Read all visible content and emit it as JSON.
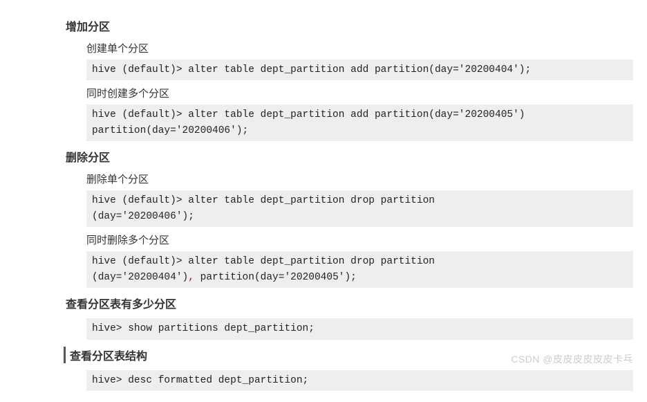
{
  "sec1": {
    "title": "增加分区",
    "sub1": "创建单个分区",
    "code1": "hive (default)> alter table dept_partition add partition(day='20200404');",
    "sub2": "同时创建多个分区",
    "code2": "hive (default)> alter table dept_partition add partition(day='20200405') \npartition(day='20200406');"
  },
  "sec2": {
    "title": "删除分区",
    "sub1": "删除单个分区",
    "code1": "hive (default)> alter table dept_partition drop partition \n(day='20200406');",
    "sub2": "同时删除多个分区",
    "code2a": "hive (default)> alter table dept_partition drop partition \n(day='20200404')",
    "code2comma": ",",
    "code2b": " partition(day='20200405');"
  },
  "sec3": {
    "title": "查看分区表有多少分区",
    "code1": "hive> show partitions dept_partition;"
  },
  "sec4": {
    "title": "查看分区表结构",
    "code1": "hive> desc formatted dept_partition;"
  },
  "watermark": "CSDN @皮皮皮皮皮皮卡乓",
  "chart_data": {
    "type": "table",
    "title": "Hive partition management commands",
    "sections": [
      {
        "heading": "增加分区",
        "items": [
          {
            "label": "创建单个分区",
            "command": "hive (default)> alter table dept_partition add partition(day='20200404');"
          },
          {
            "label": "同时创建多个分区",
            "command": "hive (default)> alter table dept_partition add partition(day='20200405') partition(day='20200406');"
          }
        ]
      },
      {
        "heading": "删除分区",
        "items": [
          {
            "label": "删除单个分区",
            "command": "hive (default)> alter table dept_partition drop partition (day='20200406');"
          },
          {
            "label": "同时删除多个分区",
            "command": "hive (default)> alter table dept_partition drop partition (day='20200404'), partition(day='20200405');"
          }
        ]
      },
      {
        "heading": "查看分区表有多少分区",
        "items": [
          {
            "label": "",
            "command": "hive> show partitions dept_partition;"
          }
        ]
      },
      {
        "heading": "查看分区表结构",
        "items": [
          {
            "label": "",
            "command": "hive> desc formatted dept_partition;"
          }
        ]
      }
    ]
  }
}
